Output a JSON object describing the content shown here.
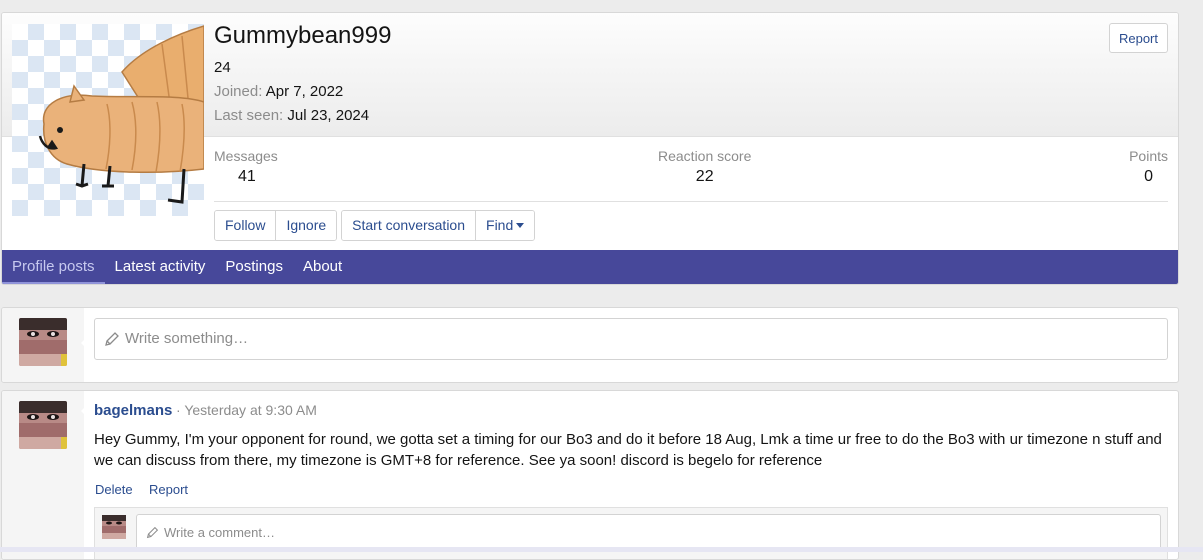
{
  "profile": {
    "username": "Gummybean999",
    "age": "24",
    "joined_label": "Joined:",
    "joined_value": "Apr 7, 2022",
    "last_seen_label": "Last seen:",
    "last_seen_value": "Jul 23, 2024",
    "report_label": "Report"
  },
  "stats": [
    {
      "label": "Messages",
      "value": "41"
    },
    {
      "label": "Reaction score",
      "value": "22"
    },
    {
      "label": "Points",
      "value": "0"
    }
  ],
  "actions": {
    "follow": "Follow",
    "ignore": "Ignore",
    "start_conversation": "Start conversation",
    "find": "Find"
  },
  "tabs": [
    {
      "label": "Profile posts",
      "active": true
    },
    {
      "label": "Latest activity",
      "active": false
    },
    {
      "label": "Postings",
      "active": false
    },
    {
      "label": "About",
      "active": false
    }
  ],
  "composer": {
    "placeholder": "Write something…"
  },
  "post": {
    "author": "bagelmans",
    "time": "Yesterday at 9:30 AM",
    "separator": "·",
    "body": "Hey Gummy, I'm your opponent for round, we gotta set a timing for our Bo3 and do it before 18 Aug, Lmk a time ur free to do the Bo3 with ur timezone n stuff and we can discuss from there, my timezone is GMT+8 for reference. See ya soon! discord is begelo for reference",
    "delete_label": "Delete",
    "report_label": "Report",
    "comment_placeholder": "Write a comment…"
  },
  "colors": {
    "tab_bar": "#47489a",
    "link": "#2b4d8f",
    "muted": "#8c8c8c"
  }
}
